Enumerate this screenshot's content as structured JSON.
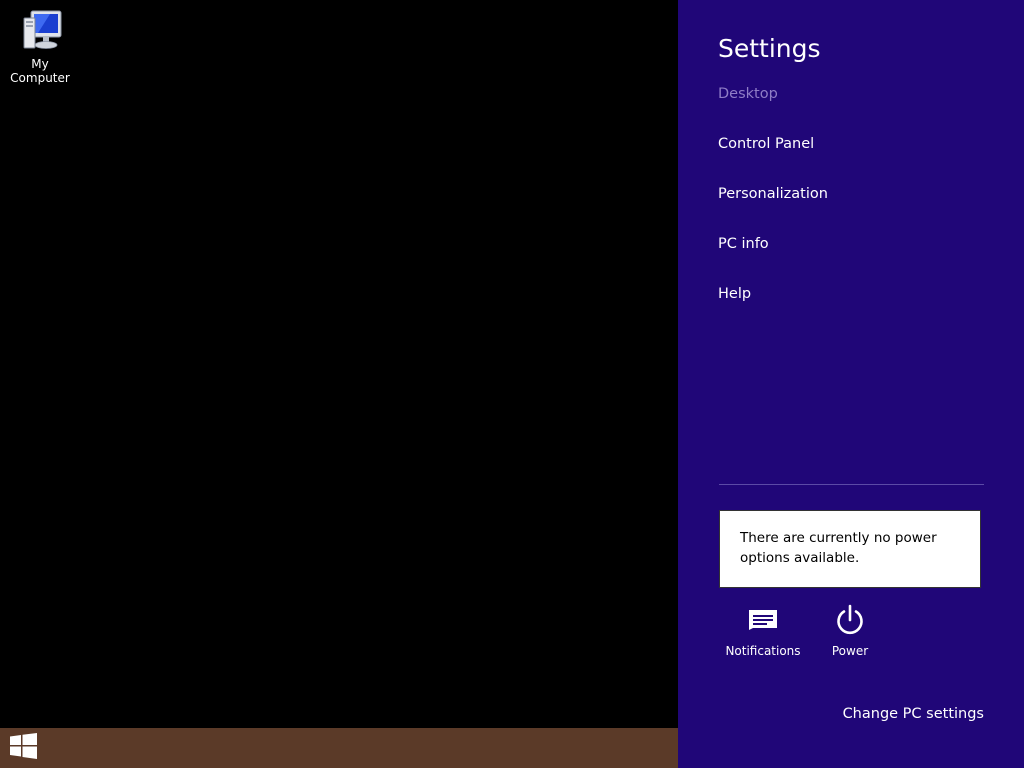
{
  "desktop": {
    "icons": [
      {
        "label": "My Computer",
        "icon": "my-computer-icon"
      }
    ]
  },
  "taskbar": {
    "start_icon": "windows-logo-icon",
    "color": "#5b3a28"
  },
  "charm": {
    "title": "Settings",
    "background": "#200678",
    "items": [
      {
        "label": "Desktop",
        "dim": true
      },
      {
        "label": "Control Panel"
      },
      {
        "label": "Personalization"
      },
      {
        "label": "PC info"
      },
      {
        "label": "Help"
      }
    ],
    "power_message": "There are currently no power options available.",
    "buttons": [
      {
        "label": "Notifications",
        "icon": "notifications-icon"
      },
      {
        "label": "Power",
        "icon": "power-icon"
      }
    ],
    "change_settings_label": "Change PC settings"
  }
}
